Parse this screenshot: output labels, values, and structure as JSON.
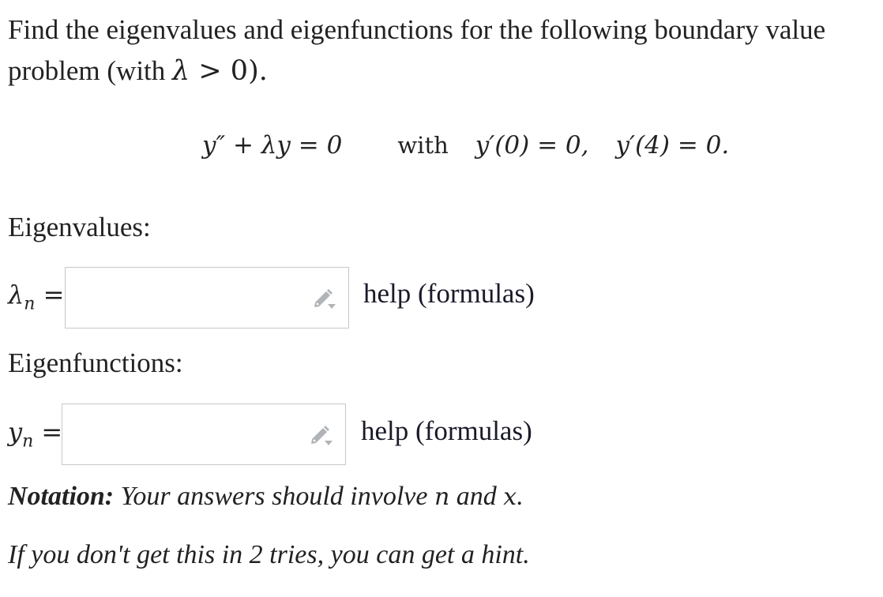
{
  "prompt": {
    "line1": "Find the eigenvalues and eigenfunctions for the following boundary value",
    "line2_prefix": "problem (with ",
    "line2_lambda": "λ",
    "line2_suffix": " > 0)."
  },
  "equation": {
    "ode": "y″ + λy = 0",
    "with_word": "with",
    "bc1": "y′(0) = 0,",
    "bc2": "y′(4) = 0."
  },
  "eigenvalues": {
    "heading": "Eigenvalues:",
    "symbol": "λ",
    "subscript": "n",
    "equals": "=",
    "input_value": "",
    "help_label": "help (formulas)"
  },
  "eigenfunctions": {
    "heading": "Eigenfunctions:",
    "symbol": "y",
    "subscript": "n",
    "equals": "=",
    "input_value": "",
    "help_label": "help (formulas)"
  },
  "notation": {
    "label": "Notation:",
    "text_prefix": " Your answers should involve ",
    "var1": "n",
    "text_mid": " and ",
    "var2": "x",
    "text_suffix": "."
  },
  "hint": {
    "text": "If you don't get this in 2 tries, you can get a hint."
  },
  "icons": {
    "input_tool": "pencil-dropdown-icon"
  },
  "colors": {
    "text": "#222222",
    "input_border": "#c8c8c8",
    "icon_gray": "#b0b4b8"
  }
}
